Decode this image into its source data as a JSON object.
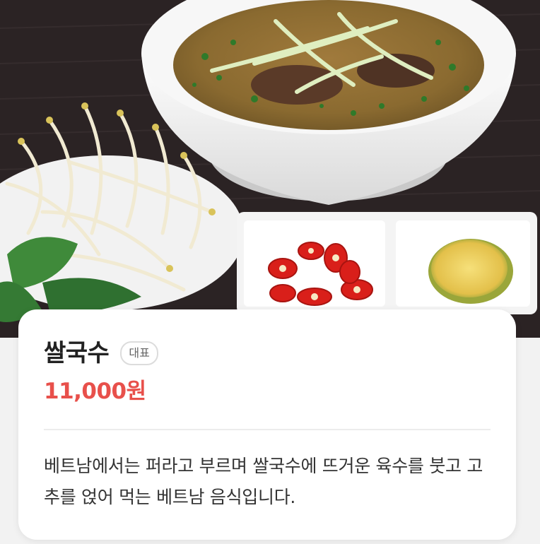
{
  "hero": {
    "alt": "쌀국수 사진"
  },
  "menu": {
    "name": "쌀국수",
    "badge": "대표",
    "price": "11,000원",
    "description": "베트남에서는 퍼라고 부르며 쌀국수에 뜨거운 육수를 붓고 고추를 얹어 먹는 베트남 음식입니다."
  },
  "colors": {
    "price": "#e8504b",
    "card_background": "#ffffff",
    "page_background": "#f2f2f2"
  }
}
